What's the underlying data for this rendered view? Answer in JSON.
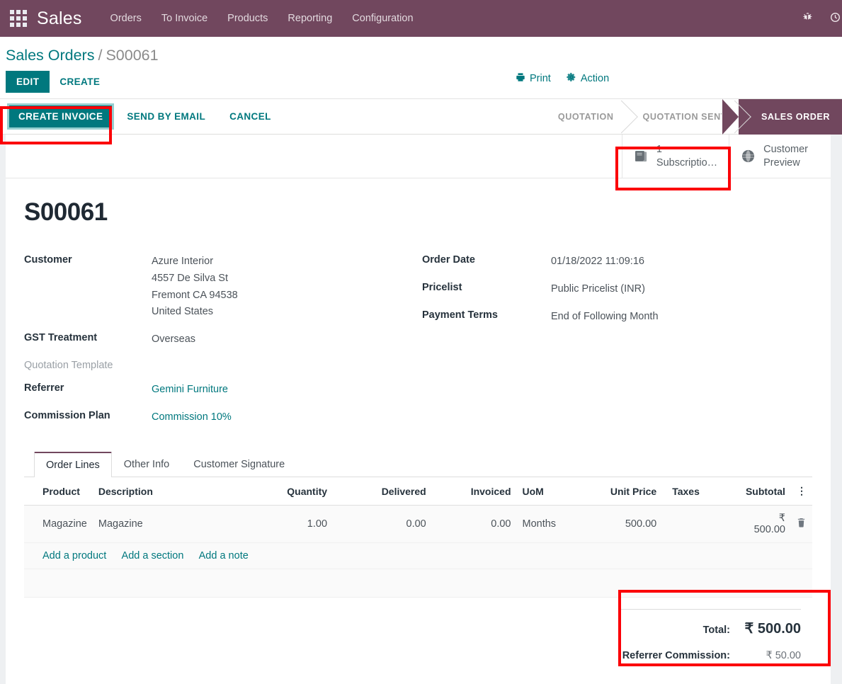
{
  "navbar": {
    "apps_icon": "apps-grid-icon",
    "brand": "Sales",
    "menu": [
      "Orders",
      "To Invoice",
      "Products",
      "Reporting",
      "Configuration"
    ],
    "right_icons": [
      {
        "name": "bug-icon",
        "glyph": "🐞"
      },
      {
        "name": "clock-icon",
        "glyph": "◔"
      }
    ],
    "colors": {
      "background": "#71475e",
      "text": "#ffffff"
    }
  },
  "breadcrumb": {
    "root": "Sales Orders",
    "separator": "/",
    "current": "S00061"
  },
  "control_panel": {
    "edit_label": "EDIT",
    "create_label": "CREATE",
    "print_label": "Print",
    "print_icon": "printer-icon",
    "action_label": "Action",
    "action_icon": "gear-icon"
  },
  "statusbar": {
    "buttons": [
      "CREATE INVOICE",
      "SEND BY EMAIL",
      "CANCEL"
    ],
    "primary_button": "CREATE INVOICE",
    "stages": [
      "QUOTATION",
      "QUOTATION SENT",
      "SALES ORDER"
    ],
    "active_stage": "SALES ORDER"
  },
  "smart_buttons": [
    {
      "icon": "book-icon",
      "count": "1",
      "label": "Subscriptio…",
      "name": "subscriptions-button"
    },
    {
      "icon": "globe-icon",
      "count": "Customer",
      "label": "Preview",
      "name": "customer-preview-button"
    }
  ],
  "record": {
    "title": "S00061",
    "left_fields": [
      {
        "label": "Customer",
        "value": "Azure Interior",
        "is_link": true,
        "extra_lines": [
          "4557 De Silva St",
          "Fremont CA 94538",
          "United States"
        ]
      },
      {
        "label": "GST Treatment",
        "value": "Overseas",
        "is_link": false
      },
      {
        "label": "Quotation Template",
        "value": "",
        "is_link": false,
        "muted_label": true
      },
      {
        "label": "Referrer",
        "value": "Gemini Furniture",
        "is_link": true
      },
      {
        "label": "Commission Plan",
        "value": "Commission 10%",
        "is_link": true
      }
    ],
    "right_fields": [
      {
        "label": "Order Date",
        "value": "01/18/2022 11:09:16"
      },
      {
        "label": "Pricelist",
        "value": "Public Pricelist (INR)"
      },
      {
        "label": "Payment Terms",
        "value": "End of Following Month"
      }
    ]
  },
  "notebook": {
    "tabs": [
      "Order Lines",
      "Other Info",
      "Customer Signature"
    ],
    "active_tab": "Order Lines"
  },
  "order_lines": {
    "columns": [
      "Product",
      "Description",
      "Quantity",
      "Delivered",
      "Invoiced",
      "UoM",
      "Unit Price",
      "Taxes",
      "Subtotal"
    ],
    "optional_columns_icon": "kebab-menu-icon",
    "rows": [
      {
        "product": "Magazine",
        "description": "Magazine",
        "quantity": "1.00",
        "delivered": "0.00",
        "invoiced": "0.00",
        "uom": "Months",
        "unit_price": "500.00",
        "taxes": "",
        "subtotal": "₹ 500.00",
        "delete_icon": "trash-icon"
      }
    ],
    "add_links": [
      "Add a product",
      "Add a section",
      "Add a note"
    ]
  },
  "totals": [
    {
      "label": "Total:",
      "value": "₹ 500.00",
      "emphasis": true
    },
    {
      "label": "Referrer Commission:",
      "value": "₹ 50.00",
      "emphasis": false
    }
  ],
  "annotations": {
    "color": "#fb0007",
    "boxes": [
      "create-invoice-button",
      "subscriptions-smart-button",
      "totals-block"
    ]
  },
  "theme": {
    "primary": "#00787e",
    "brand_purple": "#71475e",
    "text": "#4b5259",
    "heading": "#26323c"
  }
}
